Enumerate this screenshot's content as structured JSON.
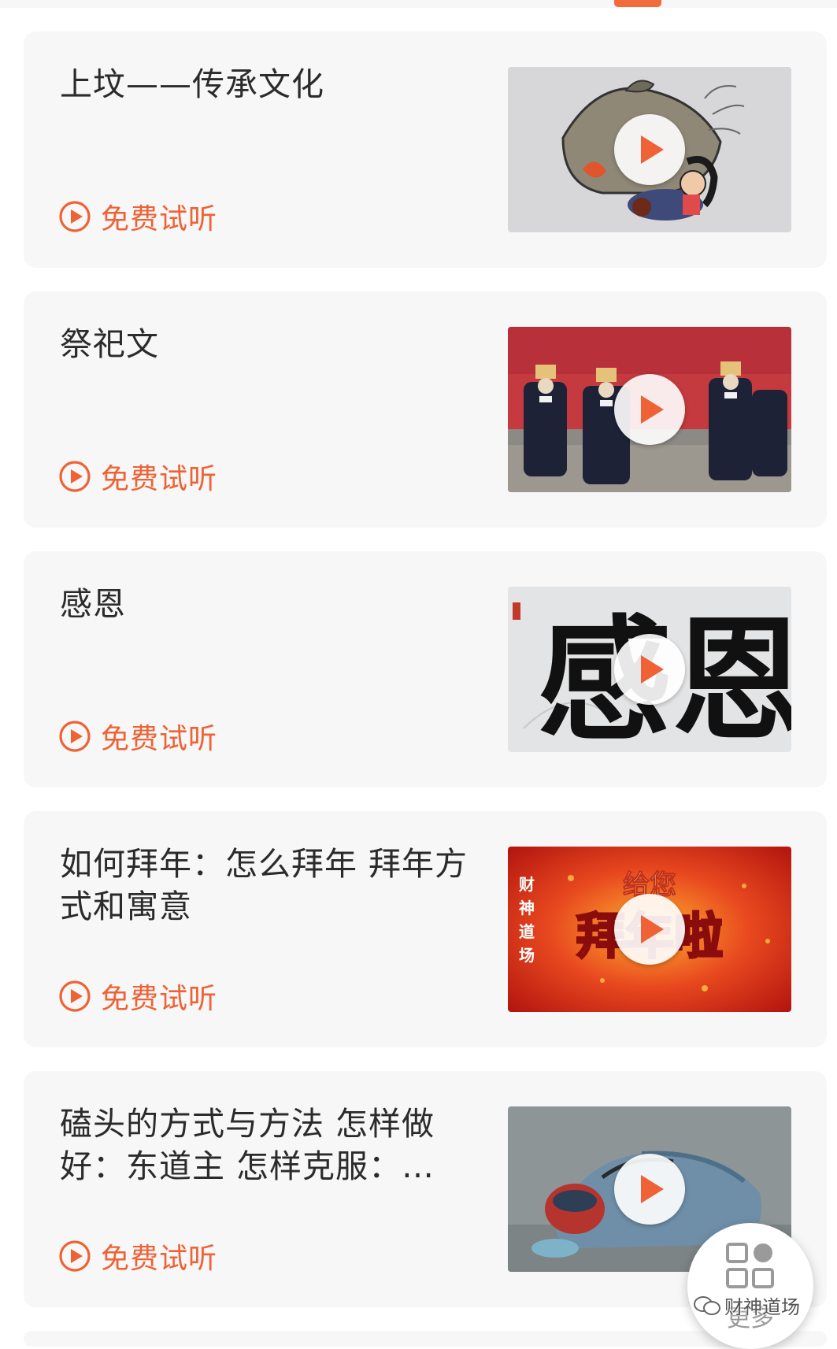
{
  "courses": [
    {
      "title": "上坟——传承文化",
      "trial_label": "免费试听",
      "thumbnail": "cartoon-grave-visit"
    },
    {
      "title": "祭祀文",
      "trial_label": "免费试听",
      "thumbnail": "ceremony-procession"
    },
    {
      "title": "感恩",
      "trial_label": "免费试听",
      "thumbnail": "calligraphy-gan-en"
    },
    {
      "title": "如何拜年：怎么拜年 拜年方式和寓意",
      "trial_label": "免费试听",
      "thumbnail": "new-year-greeting"
    },
    {
      "title": "磕头的方式与方法 怎样做好：东道主 怎样克服：…",
      "trial_label": "免费试听",
      "thumbnail": "kowtow-figurine"
    }
  ],
  "thumbnail_text": {
    "gan_en": "感恩",
    "greeting_top": "给您",
    "greeting_main": "拜年啦",
    "greeting_side": "财神道场"
  },
  "more_button": {
    "label": "更多",
    "icon": "grid-icon"
  },
  "watermark": {
    "text": "财神道场",
    "icon": "wechat-icon"
  },
  "colors": {
    "accent": "#ee6235",
    "card_bg": "#f7f7f7",
    "title_text": "#2b2b2b",
    "tab_indicator": "#f26b3a"
  }
}
